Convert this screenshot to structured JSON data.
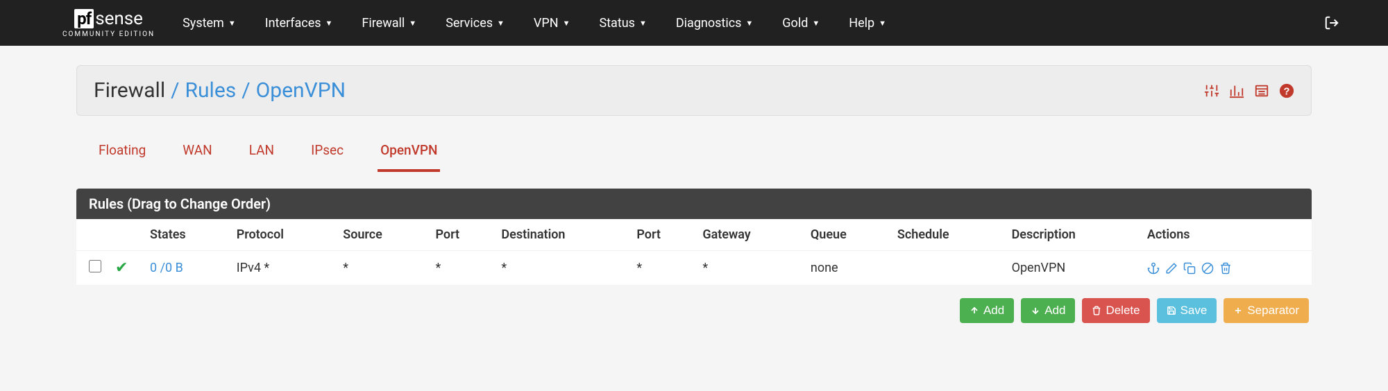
{
  "brand": {
    "pf": "pf",
    "sense": "sense",
    "sub": "COMMUNITY EDITION"
  },
  "nav": {
    "items": [
      "System",
      "Interfaces",
      "Firewall",
      "Services",
      "VPN",
      "Status",
      "Diagnostics",
      "Gold",
      "Help"
    ]
  },
  "breadcrumb": {
    "root": "Firewall",
    "mid": "Rules",
    "leaf": "OpenVPN"
  },
  "tabs": [
    "Floating",
    "WAN",
    "LAN",
    "IPsec",
    "OpenVPN"
  ],
  "activeTab": "OpenVPN",
  "panelTitle": "Rules (Drag to Change Order)",
  "columns": [
    "States",
    "Protocol",
    "Source",
    "Port",
    "Destination",
    "Port",
    "Gateway",
    "Queue",
    "Schedule",
    "Description",
    "Actions"
  ],
  "row": {
    "states": "0 /0 B",
    "protocol": "IPv4 *",
    "source": "*",
    "sport": "*",
    "destination": "*",
    "dport": "*",
    "gateway": "*",
    "queue": "none",
    "schedule": "",
    "description": "OpenVPN"
  },
  "buttons": {
    "addUp": "Add",
    "addDown": "Add",
    "delete": "Delete",
    "save": "Save",
    "separator": "Separator"
  }
}
